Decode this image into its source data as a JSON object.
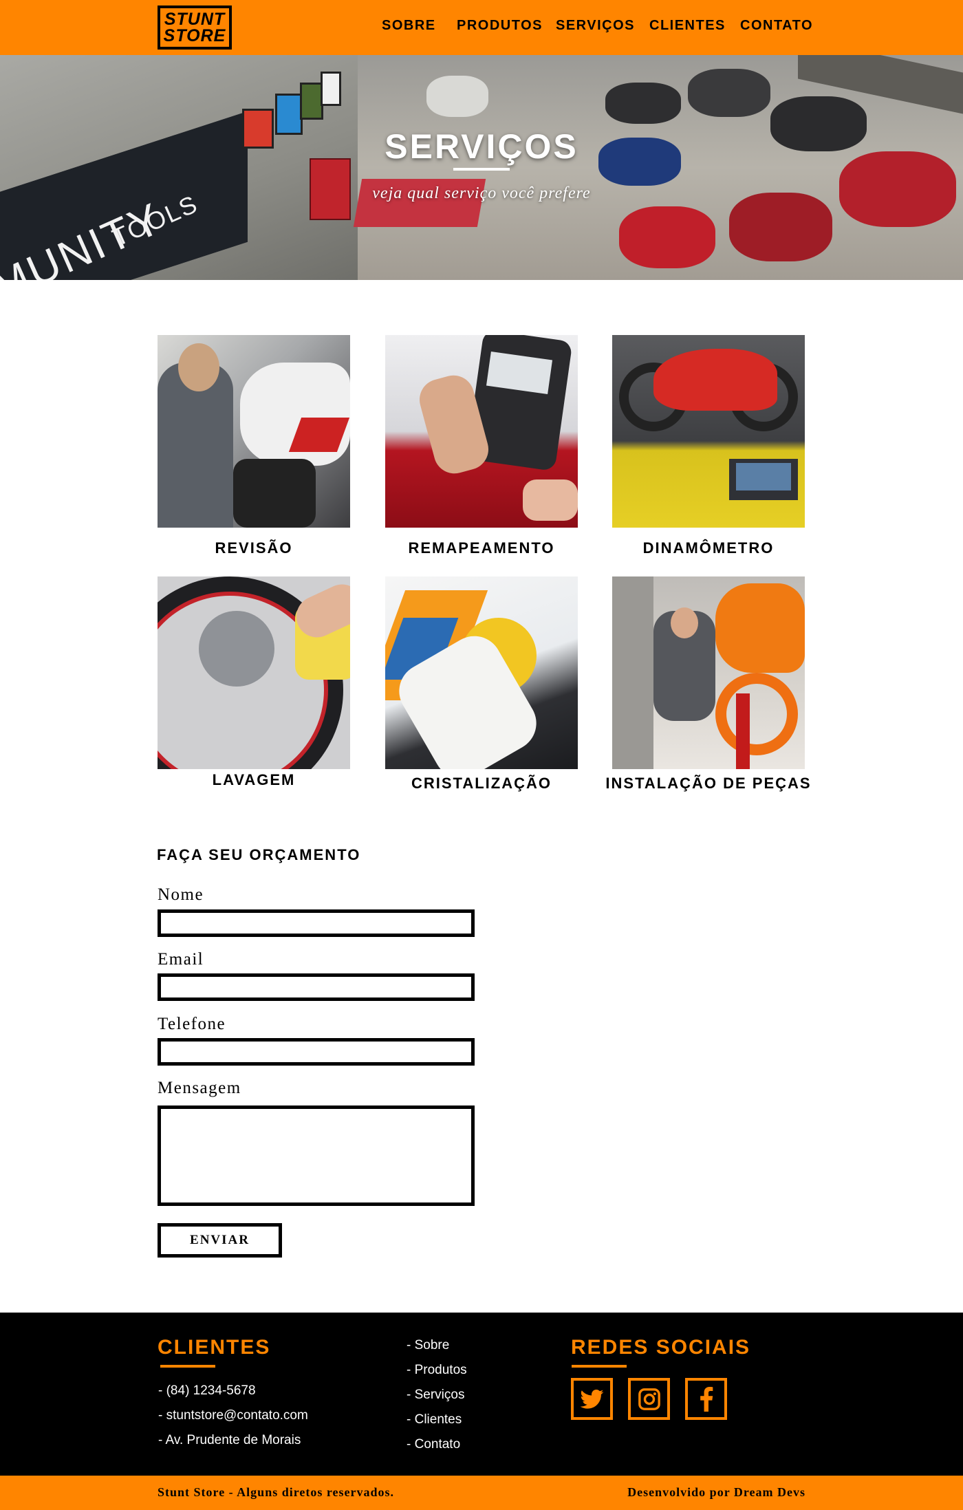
{
  "brand": {
    "logo_line1": "STUNT",
    "logo_line2": "STORE",
    "accent": "#ff8500"
  },
  "nav": {
    "items": [
      {
        "label": "SOBRE"
      },
      {
        "label": "PRODUTOS"
      },
      {
        "label": "SERVIÇOS"
      },
      {
        "label": "CLIENTES"
      },
      {
        "label": "CONTATO"
      }
    ]
  },
  "hero": {
    "title": "SERVIÇOS",
    "subtitle": "veja qual serviço você prefere",
    "sign_text": "MUNITY TOOLS"
  },
  "services": [
    {
      "label": "REVISÃO"
    },
    {
      "label": "REMAPEAMENTO"
    },
    {
      "label": "DINAMÔMETRO"
    },
    {
      "label": "LAVAGEM"
    },
    {
      "label": "CRISTALIZAÇÃO"
    },
    {
      "label": "INSTALAÇÃO DE PEÇAS"
    }
  ],
  "form": {
    "title": "FAÇA SEU ORÇAMENTO",
    "name_label": "Nome",
    "name_value": "",
    "email_label": "Email",
    "email_value": "",
    "phone_label": "Telefone",
    "phone_value": "",
    "message_label": "Mensagem",
    "message_value": "",
    "submit_label": "ENVIAR"
  },
  "footer": {
    "clients_heading": "CLIENTES",
    "contacts": [
      "- (84) 1234-5678",
      "- stuntstore@contato.com",
      "- Av. Prudente de Morais"
    ],
    "links": [
      "- Sobre",
      "- Produtos",
      "- Serviços",
      "- Clientes",
      "- Contato"
    ],
    "social_heading": "REDES SOCIAIS",
    "social_icons": [
      "twitter-icon",
      "instagram-icon",
      "facebook-icon"
    ],
    "copyright": "Stunt Store - Alguns diretos reservados.",
    "credits": "Desenvolvido por Dream Devs"
  }
}
